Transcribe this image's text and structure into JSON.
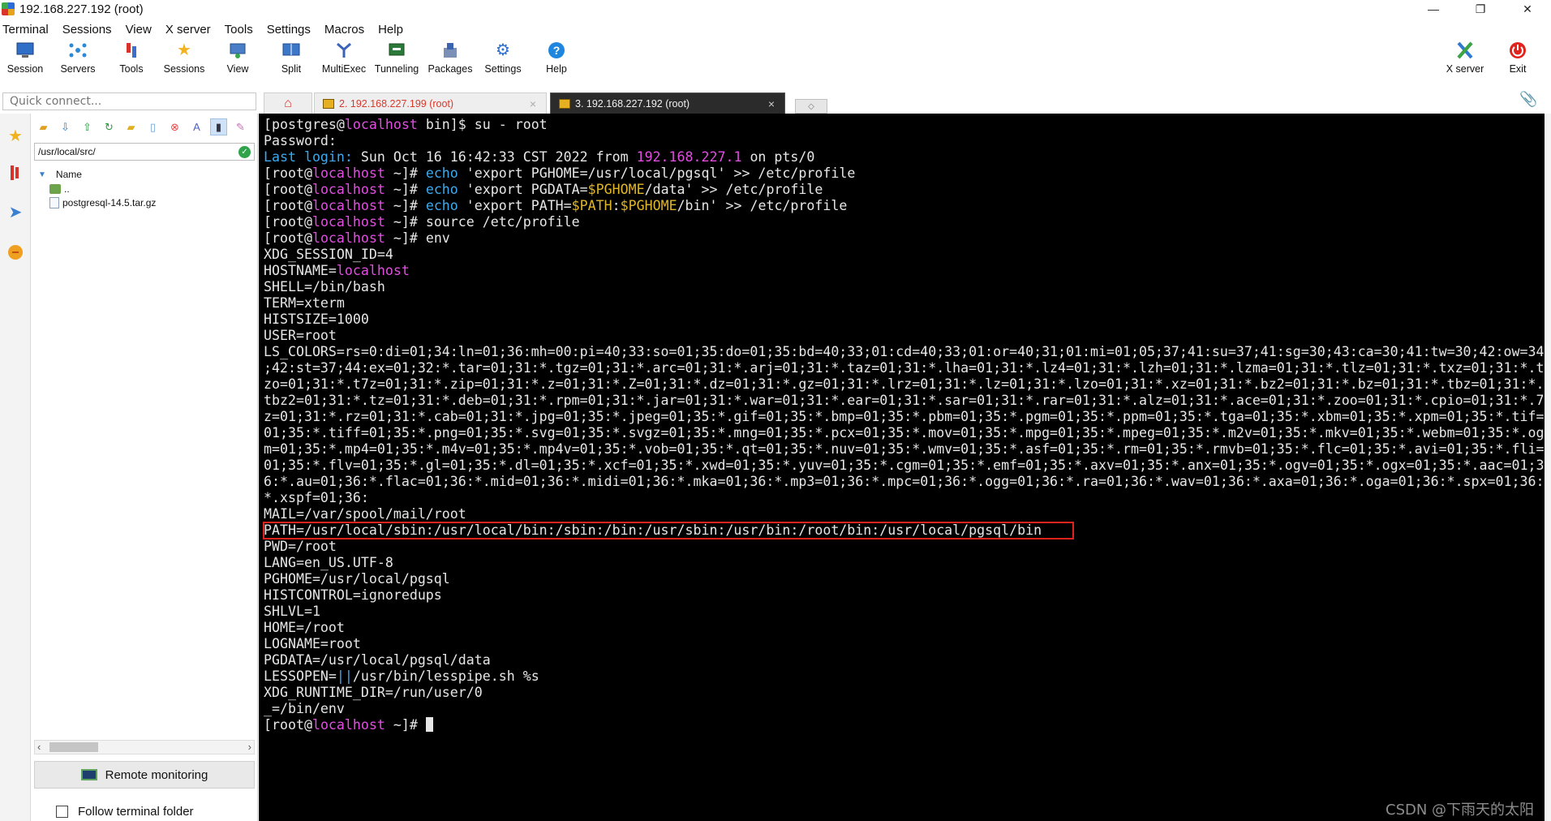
{
  "window": {
    "title": "192.168.227.192 (root)",
    "minimize": "—",
    "maximize": "❐",
    "close": "✕"
  },
  "menu": [
    "Terminal",
    "Sessions",
    "View",
    "X server",
    "Tools",
    "Settings",
    "Macros",
    "Help"
  ],
  "toolbar": {
    "items": [
      {
        "label": "Session",
        "icon": "session-icon"
      },
      {
        "label": "Servers",
        "icon": "servers-icon"
      },
      {
        "label": "Tools",
        "icon": "tools-icon"
      },
      {
        "label": "Sessions",
        "icon": "sessions-star-icon"
      },
      {
        "label": "View",
        "icon": "view-icon"
      },
      {
        "label": "Split",
        "icon": "split-icon"
      },
      {
        "label": "MultiExec",
        "icon": "multiexec-icon"
      },
      {
        "label": "Tunneling",
        "icon": "tunneling-icon"
      },
      {
        "label": "Packages",
        "icon": "packages-icon"
      },
      {
        "label": "Settings",
        "icon": "settings-icon"
      },
      {
        "label": "Help",
        "icon": "help-icon"
      }
    ],
    "xserver_label": "X server",
    "exit_label": "Exit"
  },
  "quick_connect": {
    "placeholder": "Quick connect..."
  },
  "tabs": [
    {
      "label": "2. 192.168.227.199 (root)",
      "active": false
    },
    {
      "label": "3. 192.168.227.192 (root)",
      "active": true
    }
  ],
  "sftp": {
    "path": "/usr/local/src/",
    "column_name": "Name",
    "items": [
      "..",
      "postgresql-14.5.tar.gz"
    ],
    "remote_monitoring": "Remote monitoring",
    "follow_folder": "Follow terminal folder"
  },
  "terminal": {
    "lines": [
      [
        {
          "t": "[postgres@"
        },
        {
          "t": "localhost",
          "c": "c-host"
        },
        {
          "t": " bin]$ su - root"
        }
      ],
      [
        {
          "t": "Password:"
        }
      ],
      [
        {
          "t": "Last login:",
          "c": "c-label"
        },
        {
          "t": " Sun Oct 16 16:42:33 CST 2022 from "
        },
        {
          "t": "192.168.227.1",
          "c": "c-ip"
        },
        {
          "t": " on pts/0"
        }
      ],
      [
        {
          "t": "[root@"
        },
        {
          "t": "localhost",
          "c": "c-host"
        },
        {
          "t": " ~]# "
        },
        {
          "t": "echo",
          "c": "c-cmd"
        },
        {
          "t": " 'export PGHOME=/usr/local/pgsql' >> /etc/profile"
        }
      ],
      [
        {
          "t": "[root@"
        },
        {
          "t": "localhost",
          "c": "c-host"
        },
        {
          "t": " ~]# "
        },
        {
          "t": "echo",
          "c": "c-cmd"
        },
        {
          "t": " 'export PGDATA="
        },
        {
          "t": "$PGHOME",
          "c": "c-var"
        },
        {
          "t": "/data' >> /etc/profile"
        }
      ],
      [
        {
          "t": "[root@"
        },
        {
          "t": "localhost",
          "c": "c-host"
        },
        {
          "t": " ~]# "
        },
        {
          "t": "echo",
          "c": "c-cmd"
        },
        {
          "t": " 'export PATH="
        },
        {
          "t": "$PATH",
          "c": "c-var"
        },
        {
          "t": ":"
        },
        {
          "t": "$PGHOME",
          "c": "c-var"
        },
        {
          "t": "/bin' >> /etc/profile"
        }
      ],
      [
        {
          "t": "[root@"
        },
        {
          "t": "localhost",
          "c": "c-host"
        },
        {
          "t": " ~]# source /etc/profile"
        }
      ],
      [
        {
          "t": "[root@"
        },
        {
          "t": "localhost",
          "c": "c-host"
        },
        {
          "t": " ~]# env"
        }
      ],
      [
        {
          "t": "XDG_SESSION_ID=4"
        }
      ],
      [
        {
          "t": "HOSTNAME="
        },
        {
          "t": "localhost",
          "c": "c-host"
        }
      ],
      [
        {
          "t": "SHELL=/bin/bash"
        }
      ],
      [
        {
          "t": "TERM=xterm"
        }
      ],
      [
        {
          "t": "HISTSIZE=1000"
        }
      ],
      [
        {
          "t": "USER=root"
        }
      ],
      [
        {
          "t": "LS_COLORS=rs=0:di=01;34:ln=01;36:mh=00:pi=40;33:so=01;35:do=01;35:bd=40;33;01:cd=40;33;01:or=40;31;01:mi=01;05;37;41:su=37;41:sg=30;43:ca=30;41:tw=30;42:ow=34"
        }
      ],
      [
        {
          "t": ";42:st=37;44:ex=01;32:*.tar=01;31:*.tgz=01;31:*.arc=01;31:*.arj=01;31:*.taz=01;31:*.lha=01;31:*.lz4=01;31:*.lzh=01;31:*.lzma=01;31:*.tlz=01;31:*.txz=01;31:*.t"
        }
      ],
      [
        {
          "t": "zo=01;31:*.t7z=01;31:*.zip=01;31:*.z=01;31:*.Z=01;31:*.dz=01;31:*.gz=01;31:*.lrz=01;31:*.lz=01;31:*.lzo=01;31:*.xz=01;31:*.bz2=01;31:*.bz=01;31:*.tbz=01;31:*."
        }
      ],
      [
        {
          "t": "tbz2=01;31:*.tz=01;31:*.deb=01;31:*.rpm=01;31:*.jar=01;31:*.war=01;31:*.ear=01;31:*.sar=01;31:*.rar=01;31:*.alz=01;31:*.ace=01;31:*.zoo=01;31:*.cpio=01;31:*.7"
        }
      ],
      [
        {
          "t": "z=01;31:*.rz=01;31:*.cab=01;31:*.jpg=01;35:*.jpeg=01;35:*.gif=01;35:*.bmp=01;35:*.pbm=01;35:*.pgm=01;35:*.ppm=01;35:*.tga=01;35:*.xbm=01;35:*.xpm=01;35:*.tif="
        }
      ],
      [
        {
          "t": "01;35:*.tiff=01;35:*.png=01;35:*.svg=01;35:*.svgz=01;35:*.mng=01;35:*.pcx=01;35:*.mov=01;35:*.mpg=01;35:*.mpeg=01;35:*.m2v=01;35:*.mkv=01;35:*.webm=01;35:*.og"
        }
      ],
      [
        {
          "t": "m=01;35:*.mp4=01;35:*.m4v=01;35:*.mp4v=01;35:*.vob=01;35:*.qt=01;35:*.nuv=01;35:*.wmv=01;35:*.asf=01;35:*.rm=01;35:*.rmvb=01;35:*.flc=01;35:*.avi=01;35:*.fli="
        }
      ],
      [
        {
          "t": "01;35:*.flv=01;35:*.gl=01;35:*.dl=01;35:*.xcf=01;35:*.xwd=01;35:*.yuv=01;35:*.cgm=01;35:*.emf=01;35:*.axv=01;35:*.anx=01;35:*.ogv=01;35:*.ogx=01;35:*.aac=01;3"
        }
      ],
      [
        {
          "t": "6:*.au=01;36:*.flac=01;36:*.mid=01;36:*.midi=01;36:*.mka=01;36:*.mp3=01;36:*.mpc=01;36:*.ogg=01;36:*.ra=01;36:*.wav=01;36:*.axa=01;36:*.oga=01;36:*.spx=01;36:"
        }
      ],
      [
        {
          "t": "*.xspf=01;36:"
        }
      ],
      [
        {
          "t": "MAIL=/var/spool/mail/root"
        }
      ],
      [
        {
          "t": "PATH=/usr/local/sbin:/usr/local/bin:/sbin:/bin:/usr/sbin:/usr/bin:/root/bin:/usr/local/pgsql/bin"
        }
      ],
      [
        {
          "t": "PWD=/root"
        }
      ],
      [
        {
          "t": "LANG=en_US.UTF-8"
        }
      ],
      [
        {
          "t": "PGHOME=/usr/local/pgsql"
        }
      ],
      [
        {
          "t": "HISTCONTROL=ignoredups"
        }
      ],
      [
        {
          "t": "SHLVL=1"
        }
      ],
      [
        {
          "t": "HOME=/root"
        }
      ],
      [
        {
          "t": "LOGNAME=root"
        }
      ],
      [
        {
          "t": "PGDATA=/usr/local/pgsql/data"
        }
      ],
      [
        {
          "t": "LESSOPEN="
        },
        {
          "t": "||",
          "c": "c-cmd"
        },
        {
          "t": "/usr/bin/lesspipe.sh %s"
        }
      ],
      [
        {
          "t": "XDG_RUNTIME_DIR=/run/user/0"
        }
      ],
      [
        {
          "t": "_=/bin/env"
        }
      ],
      [
        {
          "t": "[root@"
        },
        {
          "t": "localhost",
          "c": "c-host"
        },
        {
          "t": " ~]# "
        }
      ]
    ]
  },
  "watermark": "CSDN @下雨天的太阳",
  "colors": {
    "terminal_bg": "#000000",
    "prompt_host": "#e14ee0",
    "command": "#3da9f0",
    "variable": "#e0b62a",
    "highlight": "#e0221c"
  }
}
